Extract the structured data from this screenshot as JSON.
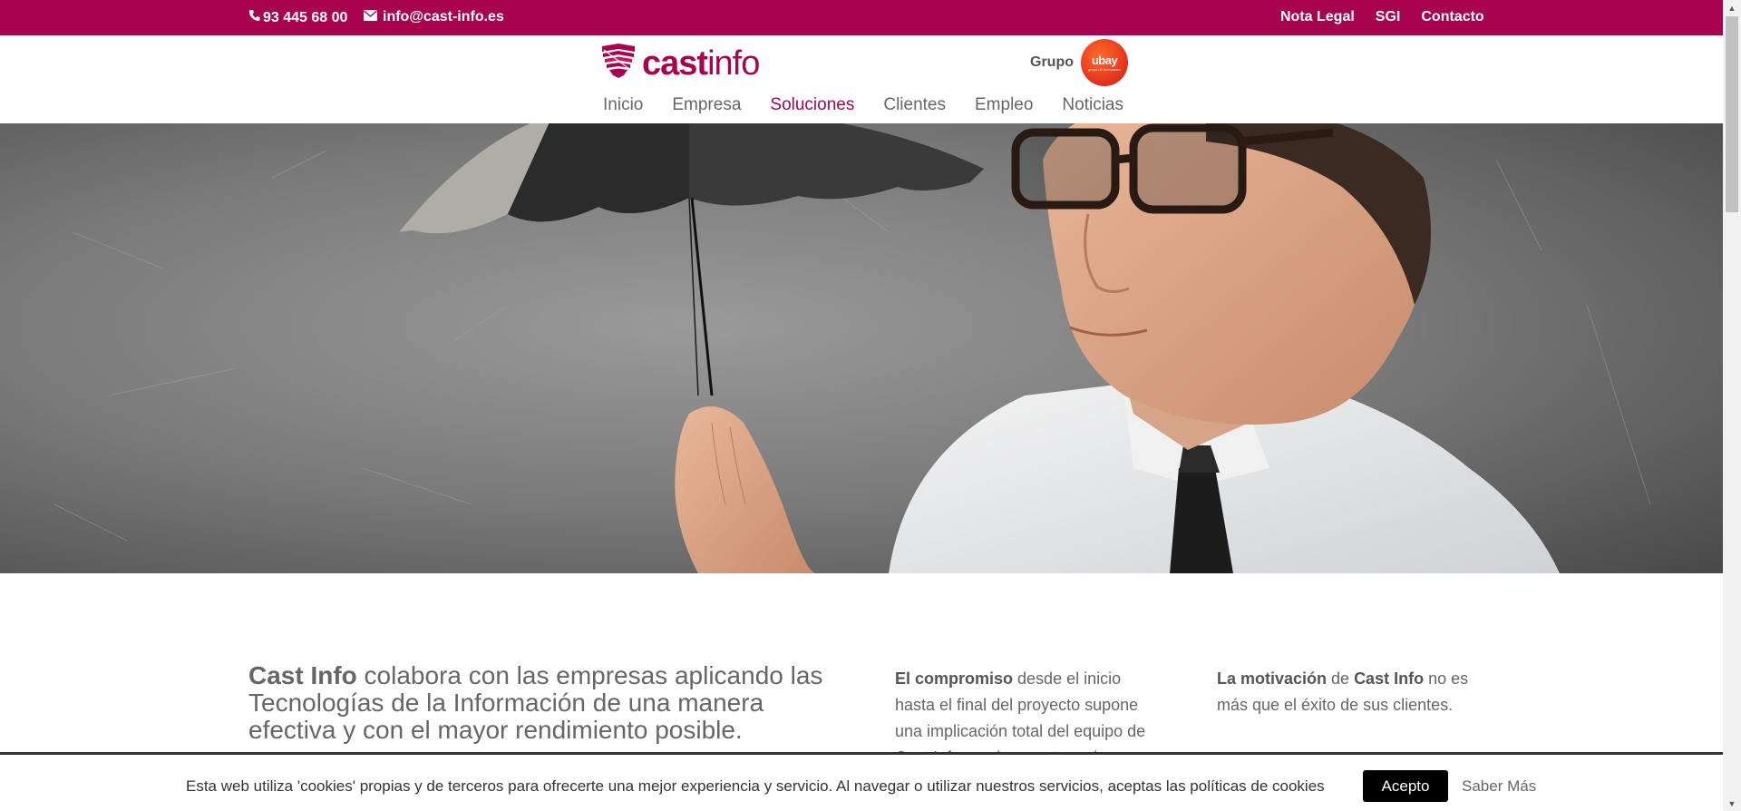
{
  "topbar": {
    "phone": "93 445 68 00",
    "email": "info@cast-info.es",
    "links": [
      "Nota Legal",
      "SGI",
      "Contacto"
    ]
  },
  "header": {
    "logo": {
      "bold": "cast",
      "light": "info"
    },
    "grupo_label": "Grupo",
    "grupo_badge": "ubay",
    "grupo_badge_sub": "grupo de innovacion",
    "nav": [
      {
        "label": "Inicio",
        "active": false
      },
      {
        "label": "Empresa",
        "active": false
      },
      {
        "label": "Soluciones",
        "active": true
      },
      {
        "label": "Clientes",
        "active": false
      },
      {
        "label": "Empleo",
        "active": false
      },
      {
        "label": "Noticias",
        "active": false
      }
    ]
  },
  "content": {
    "intro_bold": "Cast Info",
    "intro_rest": " colabora con las empresas aplicando las Tecnologías de la Información de una manera efectiva y con el mayor rendimiento posible.",
    "col2_bold": "El compromiso",
    "col2_rest": " desde el inicio hasta el final del proyecto supone una implicación total del equipo de Cast Info en el proyecto y el",
    "col3_bold1": "La motivación",
    "col3_mid": " de ",
    "col3_bold2": "Cast Info",
    "col3_rest": " no es más que el éxito de sus clientes."
  },
  "cookie": {
    "text": "Esta web utiliza 'cookies' propias y de terceros para ofrecerte una mejor experiencia y servicio. Al navegar o utilizar nuestros servicios, aceptas las políticas de cookies",
    "accept": "Acepto",
    "more": "Saber Más"
  },
  "colors": {
    "brand": "#a8034f",
    "grupo_orange": "#e2301a"
  },
  "icons": {
    "phone": "phone-icon",
    "email": "envelope-icon"
  }
}
